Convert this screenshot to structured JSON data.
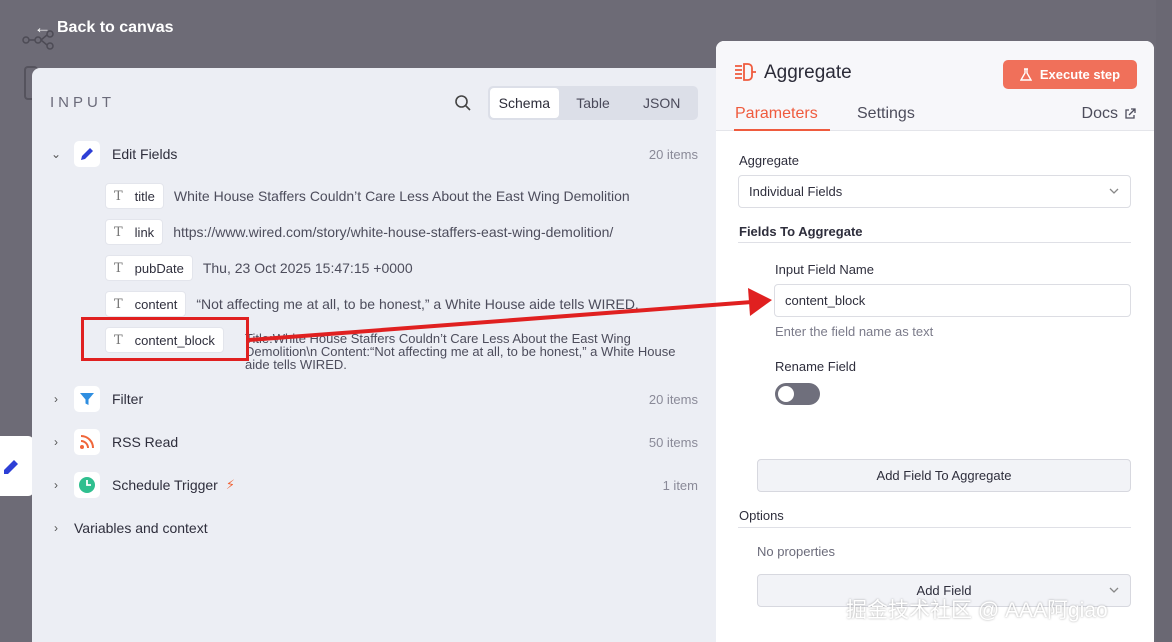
{
  "header": {
    "back_label": "Back to canvas"
  },
  "input_panel": {
    "title": "INPUT",
    "view_tabs": [
      "Schema",
      "Table",
      "JSON"
    ],
    "active_tab": "Schema",
    "nodes": [
      {
        "name": "Edit Fields",
        "count": "20 items",
        "expanded": true,
        "icon": "pencil-icon"
      },
      {
        "name": "Filter",
        "count": "20 items",
        "expanded": false,
        "icon": "filter-icon"
      },
      {
        "name": "RSS Read",
        "count": "50 items",
        "expanded": false,
        "icon": "rss-icon"
      },
      {
        "name": "Schedule Trigger",
        "count": "1 item",
        "expanded": false,
        "icon": "clock-icon"
      }
    ],
    "fields": [
      {
        "name": "title",
        "value": "White House Staffers Couldn’t Care Less About the East Wing Demolition"
      },
      {
        "name": "link",
        "value": "https://www.wired.com/story/white-house-staffers-east-wing-demolition/"
      },
      {
        "name": "pubDate",
        "value": "Thu, 23 Oct 2025 15:47:15 +0000"
      },
      {
        "name": "content",
        "value": "“Not affecting me at all, to be honest,” a White House aide tells WIRED."
      },
      {
        "name": "content_block",
        "value": "Title:White House Staffers Couldn’t Care Less About the East Wing Demolition\\n Content:“Not affecting me at all, to be honest,” a White House aide tells WIRED."
      }
    ],
    "variables_label": "Variables and context"
  },
  "node_panel": {
    "title": "Aggregate",
    "execute_label": "Execute step",
    "tabs": [
      "Parameters",
      "Settings"
    ],
    "active_tab": "Parameters",
    "docs_label": "Docs",
    "aggregate_label": "Aggregate",
    "aggregate_value": "Individual Fields",
    "fields_section": "Fields To Aggregate",
    "input_field_label": "Input Field Name",
    "input_field_value": "content_block",
    "input_field_hint": "Enter the field name as text",
    "rename_label": "Rename Field",
    "rename_on": false,
    "add_field_button": "Add Field To Aggregate",
    "options_label": "Options",
    "no_properties": "No properties",
    "add_field_select": "Add Field"
  },
  "watermark": "掘金技术社区 @ AAA阿giao",
  "colors": {
    "accent": "#ef5b3e",
    "annotation": "#e02020"
  }
}
